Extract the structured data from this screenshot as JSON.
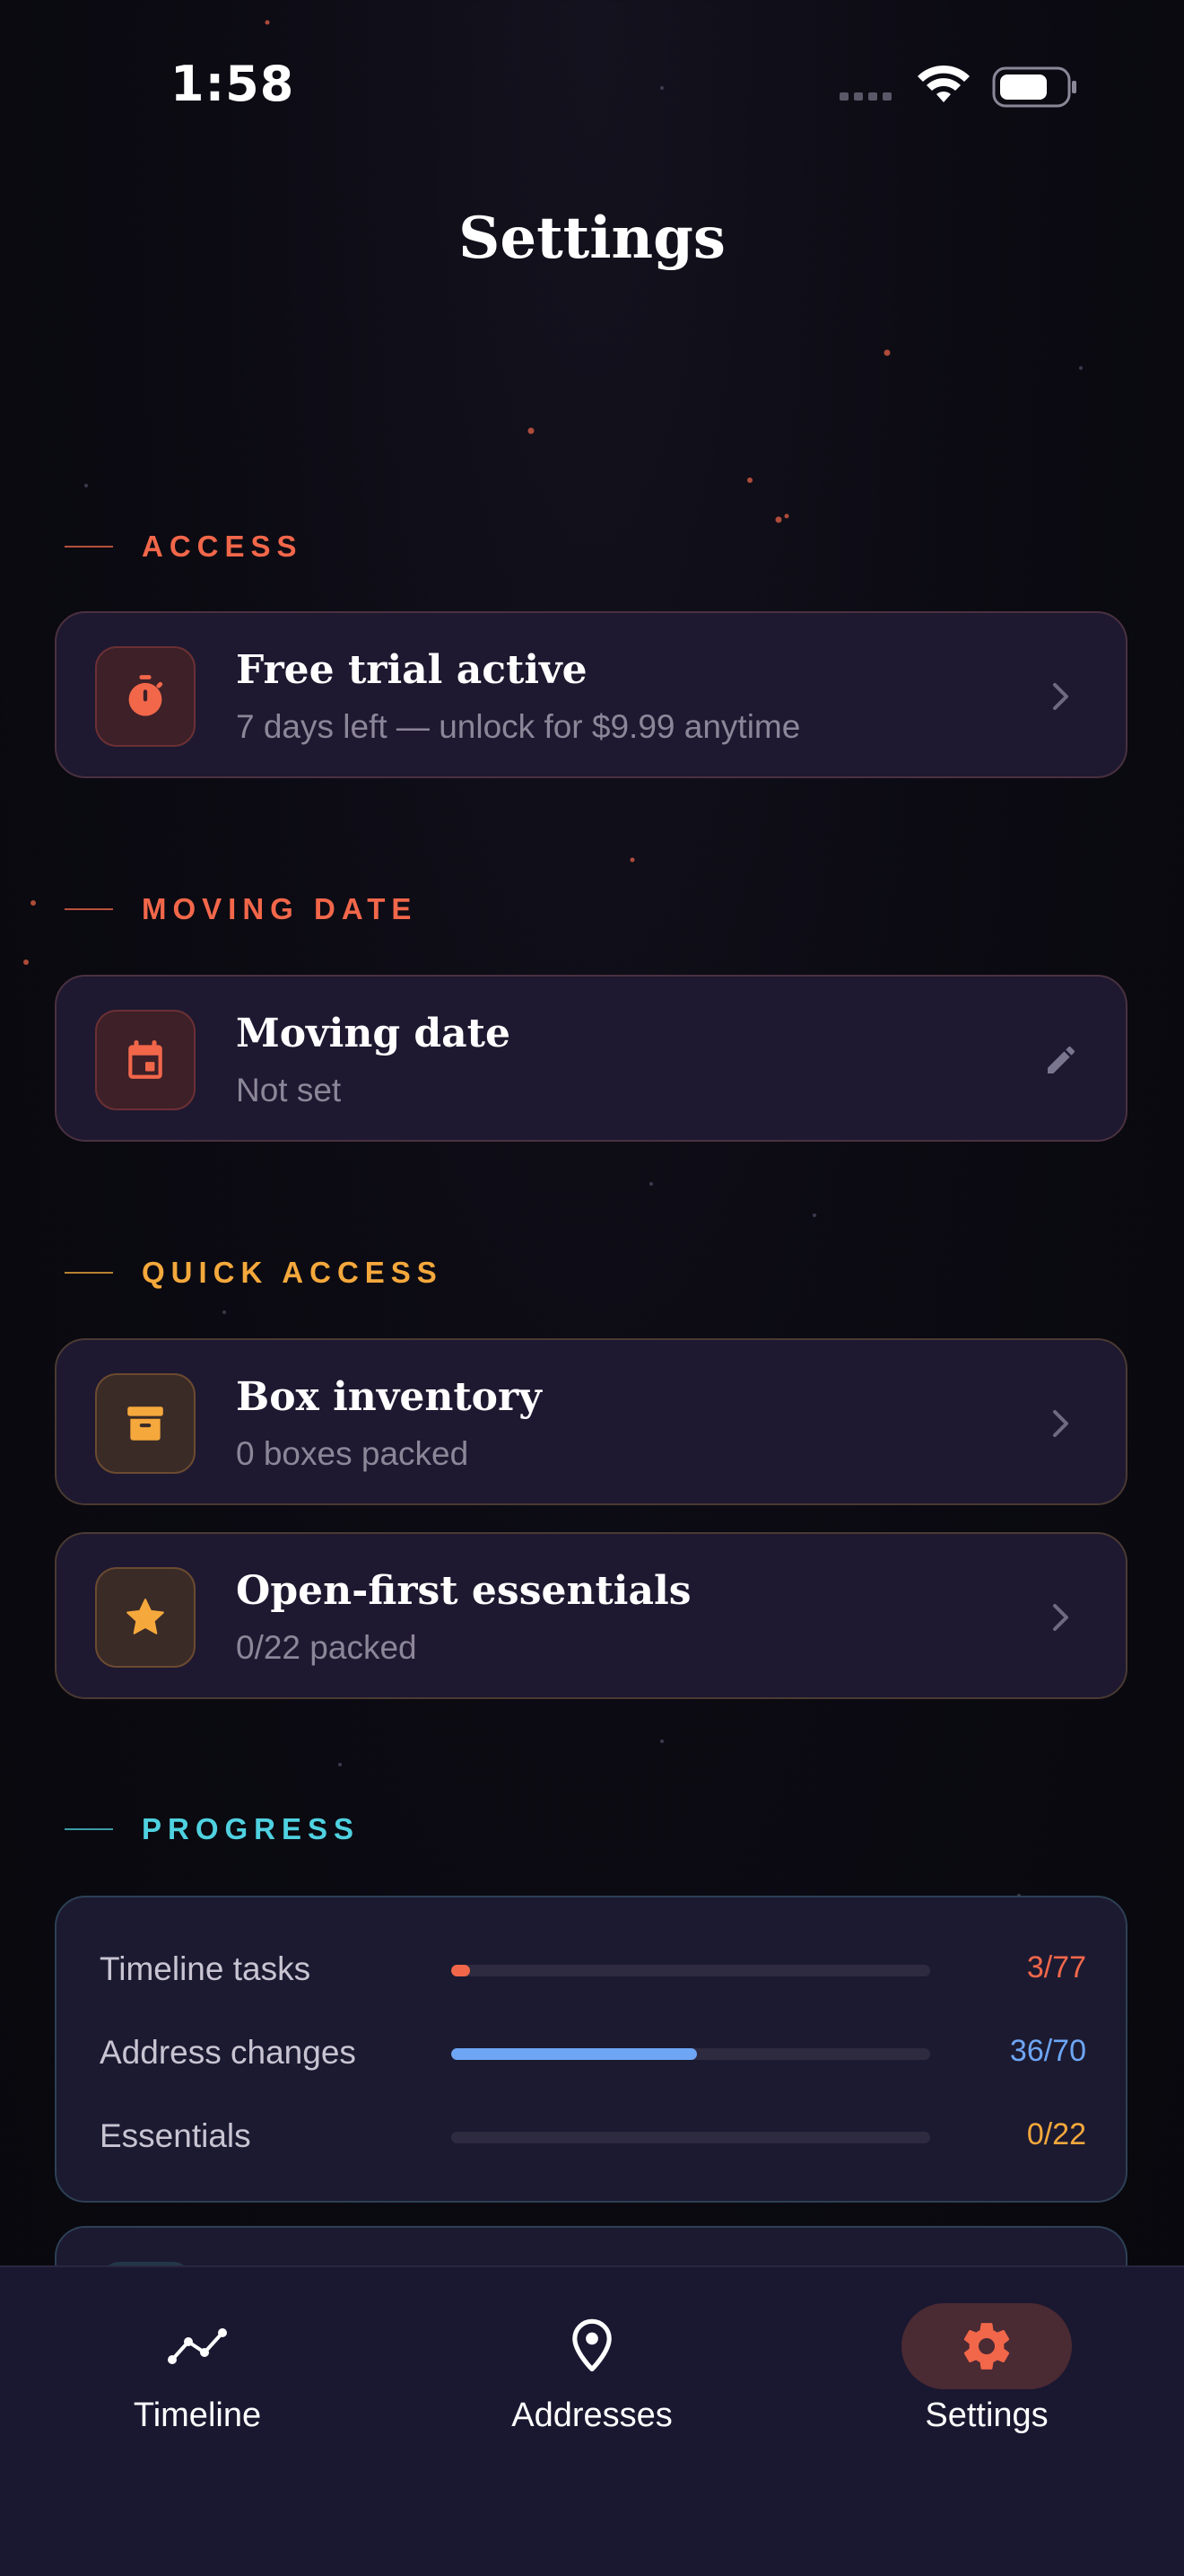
{
  "status_bar": {
    "time": "1:58"
  },
  "page": {
    "title": "Settings"
  },
  "colors": {
    "red_accent": "#f2674a",
    "amber_accent": "#f5a83c",
    "blue_accent": "#6ea6f5",
    "cyan_accent": "#4fd1e0",
    "card_bg": "#1e1930"
  },
  "sections": {
    "access": {
      "header": "ACCESS",
      "card": {
        "title": "Free trial active",
        "subtitle": "7 days left — unlock for $9.99 anytime",
        "icon": "stopwatch-icon",
        "trailing_icon": "chevron-right-icon"
      }
    },
    "moving_date": {
      "header": "MOVING DATE",
      "card": {
        "title": "Moving date",
        "subtitle": "Not set",
        "icon": "calendar-icon",
        "trailing_icon": "pencil-icon"
      }
    },
    "quick_access": {
      "header": "QUICK ACCESS",
      "cards": [
        {
          "title": "Box inventory",
          "subtitle": "0 boxes packed",
          "icon": "archive-box-icon",
          "trailing_icon": "chevron-right-icon"
        },
        {
          "title": "Open-first essentials",
          "subtitle": "0/22 packed",
          "icon": "star-icon",
          "trailing_icon": "chevron-right-icon"
        }
      ]
    },
    "progress": {
      "header": "PROGRESS",
      "rows": [
        {
          "label": "Timeline tasks",
          "value": "3/77",
          "fraction": 0.039,
          "color": "#f2674a"
        },
        {
          "label": "Address changes",
          "value": "36/70",
          "fraction": 0.514,
          "color": "#6ea6f5"
        },
        {
          "label": "Essentials",
          "value": "0/22",
          "fraction": 0,
          "color": "#f5a83c"
        }
      ]
    }
  },
  "tab_bar": {
    "tabs": [
      {
        "label": "Timeline",
        "icon": "trend-line-icon",
        "active": false
      },
      {
        "label": "Addresses",
        "icon": "map-pin-icon",
        "active": false
      },
      {
        "label": "Settings",
        "icon": "gear-icon",
        "active": true
      }
    ]
  }
}
